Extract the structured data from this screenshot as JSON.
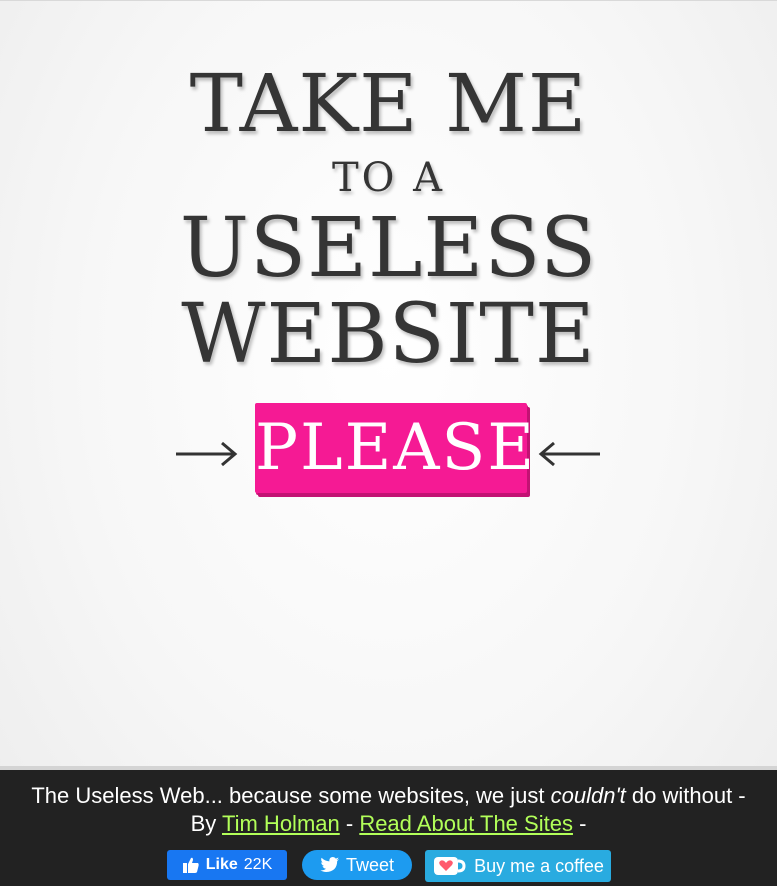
{
  "hero": {
    "line1": "TAKE ME",
    "line2": "TO A",
    "line3": "USELESS",
    "line4": "WEBSITE",
    "button_label": "PLEASE"
  },
  "footer": {
    "text_before": "The Useless Web... because some websites, we just ",
    "text_emphasis": "couldn't",
    "text_after": " do without - By ",
    "author_link": "Tim Holman",
    "separator1": " - ",
    "read_link": "Read About The Sites",
    "separator2": " -"
  },
  "social": {
    "like_label": "Like",
    "like_count": "22K",
    "tweet_label": "Tweet",
    "coffee_label": "Buy me a coffee"
  },
  "colors": {
    "please_bg": "#f51a94",
    "footer_bg": "#222222",
    "link": "#b2ff59",
    "facebook": "#1877f2",
    "twitter": "#1d9bf0",
    "coffee": "#29abe0"
  },
  "icons": [
    "arrow-right-icon",
    "arrow-left-icon",
    "thumbs-up-icon",
    "twitter-bird-icon",
    "coffee-cup-icon"
  ]
}
